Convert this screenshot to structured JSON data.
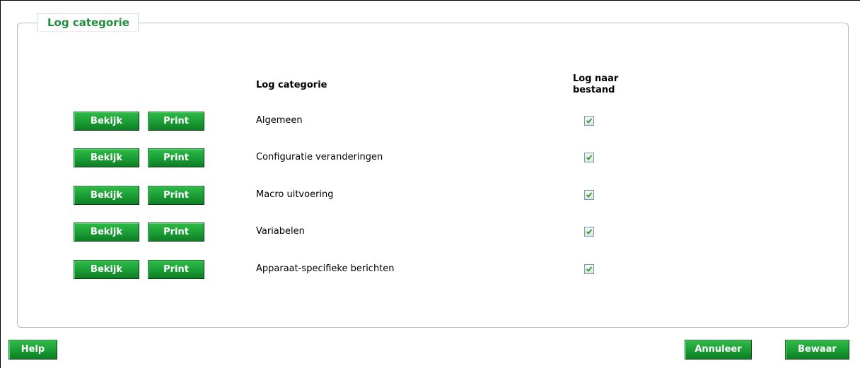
{
  "panel": {
    "legend": "Log categorie"
  },
  "table": {
    "headers": {
      "category": "Log categorie",
      "log_to_file_line1": "Log naar",
      "log_to_file_line2": "bestand"
    },
    "view_label": "Bekijk",
    "print_label": "Print",
    "rows": [
      {
        "category": "Algemeen",
        "log_to_file": true
      },
      {
        "category": "Configuratie veranderingen",
        "log_to_file": true
      },
      {
        "category": "Macro uitvoering",
        "log_to_file": true
      },
      {
        "category": "Variabelen",
        "log_to_file": true
      },
      {
        "category": "Apparaat-specifieke berichten",
        "log_to_file": true
      }
    ]
  },
  "footer": {
    "help_label": "Help",
    "cancel_label": "Annuleer",
    "save_label": "Bewaar"
  },
  "colors": {
    "accent_green": "#1ea238",
    "legend_text": "#1f8c3b",
    "checkmark": "#2a9a2a"
  },
  "icons": {
    "checkbox_checked": "checkmark-icon"
  }
}
